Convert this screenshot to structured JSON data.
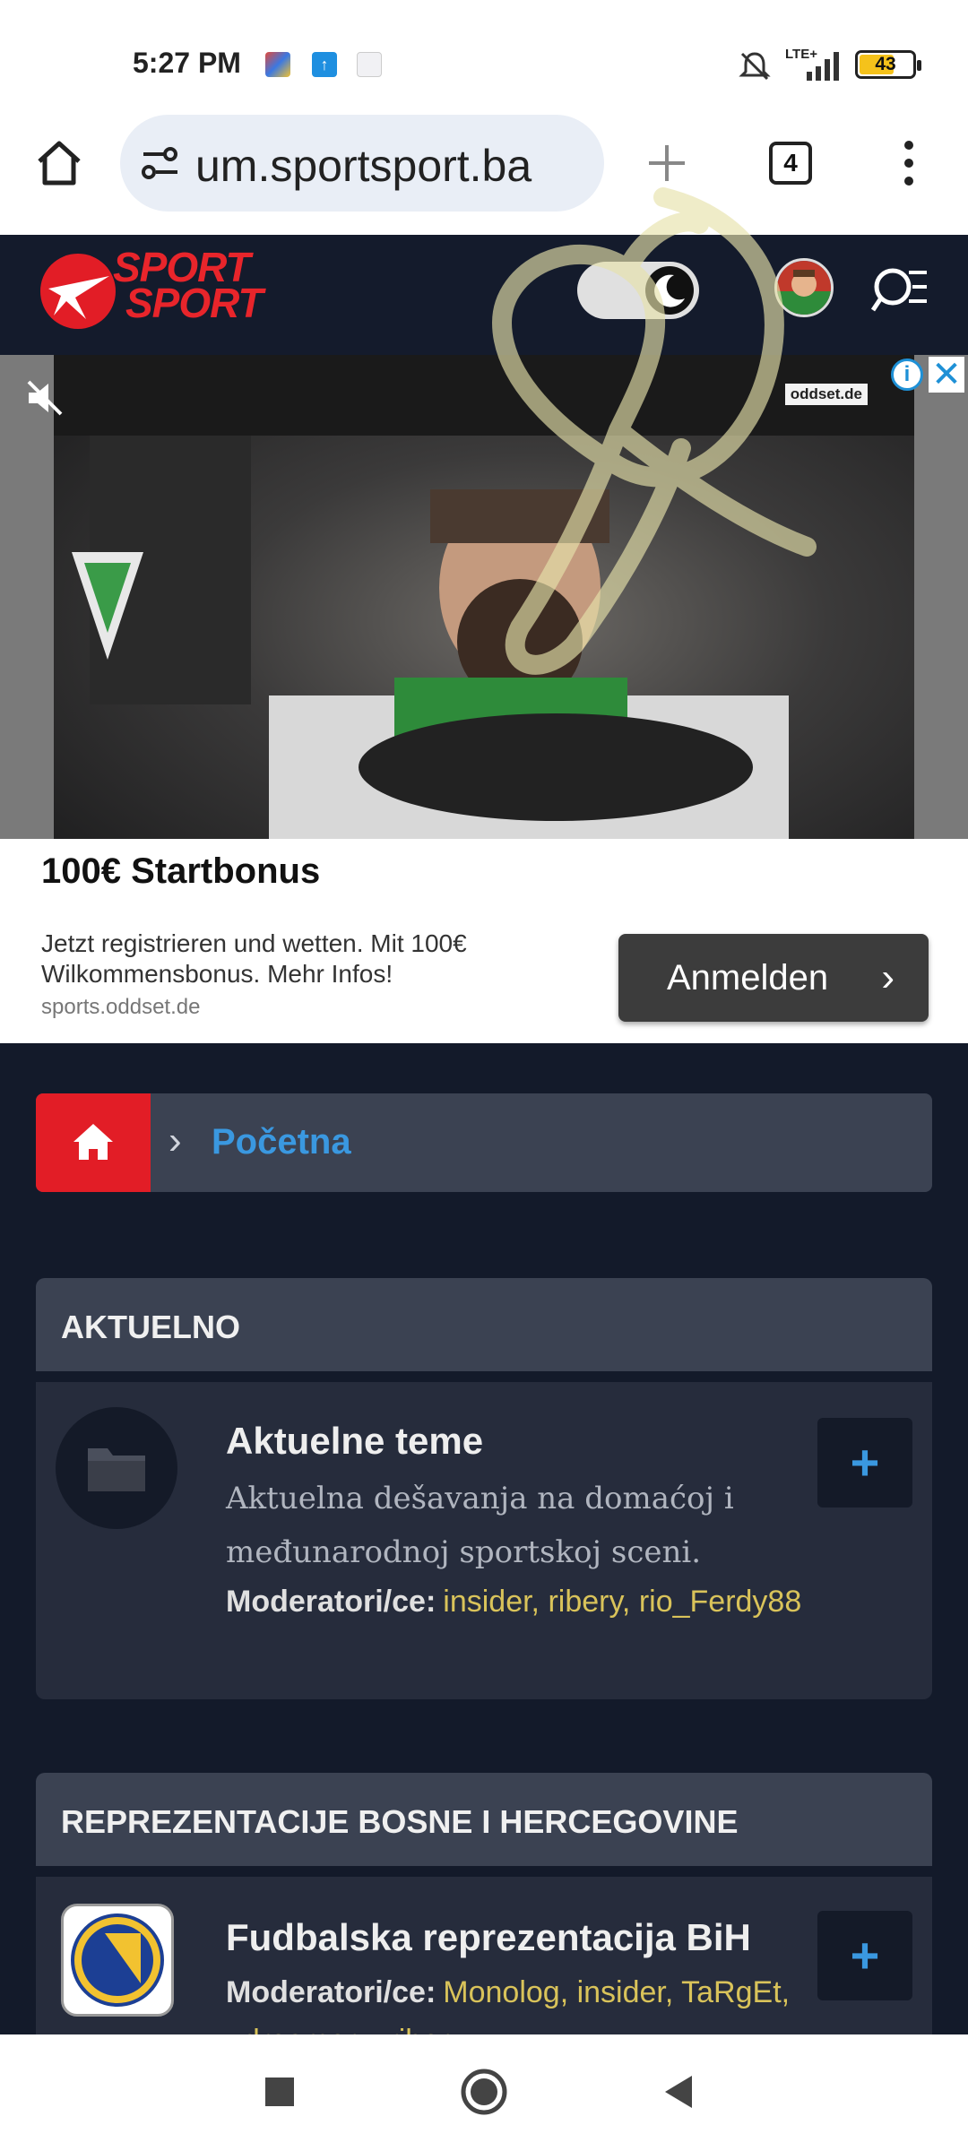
{
  "status_bar": {
    "time": "5:27 PM",
    "network": "LTE+",
    "battery": "43",
    "battery_level": 0.43
  },
  "browser": {
    "url": "um.sportsport.ba",
    "tab_count": "4"
  },
  "site": {
    "logo_line1": "SPORT",
    "logo_line2": "SPORT"
  },
  "ad": {
    "brand": "oddset.de",
    "title": "100€ Startbonus",
    "description": "Jetzt registrieren und wetten. Mit 100€ Wilkommensbonus. Mehr Infos!",
    "domain": "sports.oddset.de",
    "cta": "Anmelden"
  },
  "breadcrumb": {
    "current": "Početna"
  },
  "sections": {
    "aktuelno": {
      "header": "AKTUELNO",
      "forum_title": "Aktuelne teme",
      "forum_desc": "Aktuelna dešavanja na domaćoj i međunarodnoj sportskoj sceni.",
      "mods_label": "Moderatori/ce:",
      "mods": "insider, ribery, rio_Ferdy88"
    },
    "reprezentacije": {
      "header": "REPREZENTACIJE BOSNE I HERCEGOVINE",
      "forum_title": "Fudbalska reprezentacija BiH",
      "mods_label": "Moderatori/ce:",
      "mods": "Monolog, insider, TaRgEt, ..dreamer.., ribery"
    }
  },
  "colors": {
    "header_bg": "#141b2c",
    "accent_red": "#e21d26",
    "link_blue": "#3a98e0",
    "mod_yellow": "#d9c35a"
  }
}
